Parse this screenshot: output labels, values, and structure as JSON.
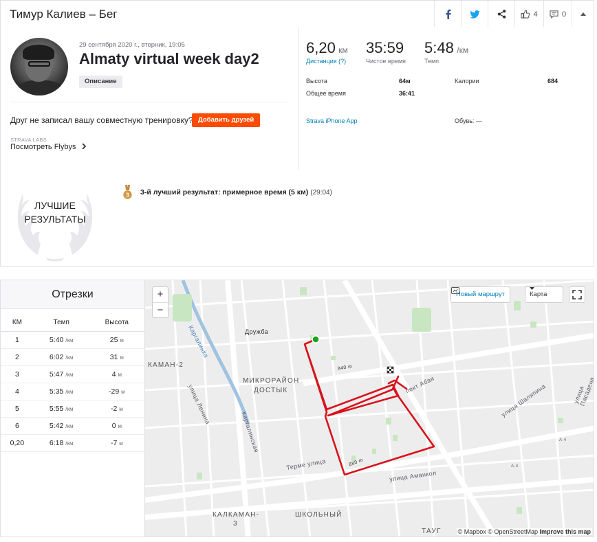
{
  "header": {
    "title": "Тимур Калиев – Бег",
    "kudos_count": "4",
    "comments_count": "0"
  },
  "activity": {
    "datetime": "29 сентября 2020 г., вторник, 19:05",
    "name": "Almaty virtual week day2",
    "description_button": "Описание",
    "friend_prompt": "Друг не записал вашу совместную тренировку?",
    "add_friends_button": "Добавить друзей",
    "labs_label": "STRAVA LABS",
    "flyby_link": "Посмотреть Flybys"
  },
  "stats": {
    "distance": {
      "value": "6,20",
      "unit": "км",
      "label": "Дистанция (?)"
    },
    "moving_time": {
      "value": "35:59",
      "label": "Чистое время"
    },
    "pace": {
      "value": "5:48",
      "unit": "/км",
      "label": "Темп"
    },
    "elevation_label": "Высота",
    "elevation_value": "64м",
    "elapsed_label": "Общее время",
    "elapsed_value": "36:41",
    "calories_label": "Калории",
    "calories_value": "684",
    "device": "Strava iPhone App",
    "shoes": "Обувь: —"
  },
  "best_efforts": {
    "wreath_line1": "ЛУЧШИЕ",
    "wreath_line2": "РЕЗУЛЬТАТЫ",
    "medal_rank": "3",
    "item_text": "3-й лучший результат: примерное время (5 км)",
    "item_time": "(29:04)"
  },
  "splits": {
    "title": "Отрезки",
    "headers": [
      "КМ",
      "Темп",
      "Высота"
    ],
    "unit_pace": "/км",
    "unit_elev": "м",
    "rows": [
      {
        "km": "1",
        "pace": "5:40",
        "elev": "25"
      },
      {
        "km": "2",
        "pace": "6:02",
        "elev": "31"
      },
      {
        "km": "3",
        "pace": "5:47",
        "elev": "4"
      },
      {
        "km": "4",
        "pace": "5:35",
        "elev": "-29"
      },
      {
        "km": "5",
        "pace": "5:55",
        "elev": "-2"
      },
      {
        "km": "6",
        "pace": "5:42",
        "elev": "0"
      },
      {
        "km": "0,20",
        "pace": "6:18",
        "elev": "-7"
      }
    ]
  },
  "map": {
    "zoom_in": "+",
    "zoom_out": "−",
    "new_route": "Новый маршрут",
    "map_type": "Карта",
    "attribution_mapbox": "© Mapbox",
    "attribution_osm": "© OpenStreetMap",
    "attribution_improve": "Improve this map",
    "labels": {
      "druzhba": "Дружба",
      "kargalinka": "Каргалинка",
      "kalkaman2": "КАМАН-2",
      "mikro1": "МИКРОРАЙОН",
      "mikro2": "ДОСТЫК",
      "lenina": "улица Ленина",
      "kargalinskaya": "Каргалинская",
      "terme": "Терме улица",
      "abaya": "пект Абая",
      "shalyapina": "улица Шаляпина",
      "pasadena": "улица Пасадена",
      "amankol": "улица Аманкол",
      "kalkaman3a": "КАЛКАМАН-",
      "kalkaman3b": "3",
      "shkolny": "ШКОЛЬНЫЙ",
      "taug": "ТАУГ",
      "a4a": "А-4",
      "a4b": "А-4",
      "m840a": "840 m",
      "m840b": "880 m"
    },
    "route_color": "#d8121b"
  }
}
